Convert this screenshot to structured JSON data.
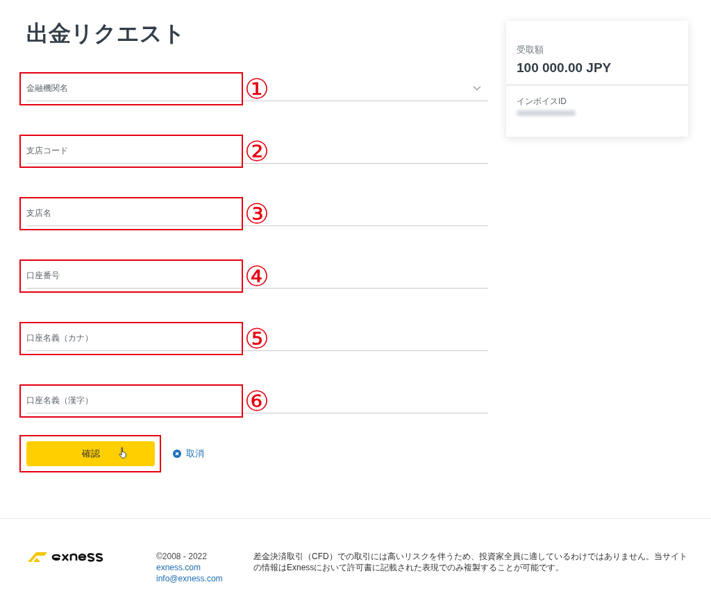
{
  "page": {
    "title": "出金リクエスト"
  },
  "fields": [
    {
      "kind": "select",
      "placeholder": "金融機関名",
      "annotated": true,
      "marker": "①"
    },
    {
      "kind": "text",
      "placeholder": "支店コード",
      "annotated": true,
      "marker": "②"
    },
    {
      "kind": "text",
      "placeholder": "支店名",
      "annotated": true,
      "marker": "③"
    },
    {
      "kind": "text",
      "placeholder": "口座番号",
      "annotated": true,
      "marker": "④"
    },
    {
      "kind": "text",
      "placeholder": "口座名義（カナ）",
      "annotated": true,
      "marker": "⑤"
    },
    {
      "kind": "text",
      "placeholder": "口座名義（漢字）",
      "annotated": true,
      "marker": "⑥"
    }
  ],
  "confirm_button": {
    "label": "確認",
    "annotated": true
  },
  "cancel_link": {
    "label": "取消"
  },
  "summary": {
    "amount_label": "受取額",
    "amount": "100 000.00 JPY",
    "invoice_label": "インボイスID"
  },
  "footer": {
    "copyright": "©2008 - 2022",
    "links": [
      "exness.com",
      "info@exness.com"
    ],
    "disclaimer": "差金決済取引（CFD）での取引には高いリスクを伴うため、投資家全員に適しているわけではありません。当サイトの情報はExnessにおいて許可書に記載された表現でのみ複製することが可能です。"
  }
}
